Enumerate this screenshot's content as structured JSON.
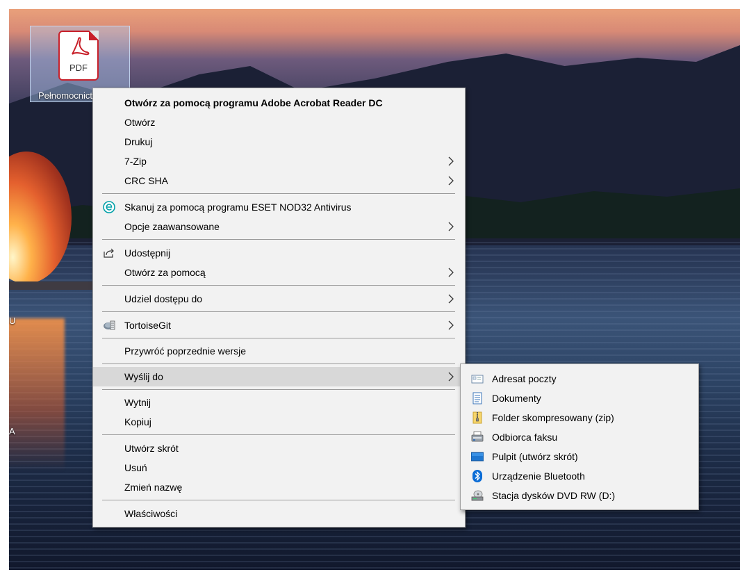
{
  "desktop": {
    "icon": {
      "label": "Pełnomocnictwo",
      "type_text": "PDF"
    },
    "edge_letters": [
      "U",
      "A"
    ]
  },
  "context_menu": {
    "items": [
      {
        "label": "Otwórz za pomocą programu Adobe Acrobat Reader DC",
        "bold": true,
        "submenu": false,
        "icon": ""
      },
      {
        "label": "Otwórz",
        "submenu": false,
        "icon": ""
      },
      {
        "label": "Drukuj",
        "submenu": false,
        "icon": ""
      },
      {
        "label": "7-Zip",
        "submenu": true,
        "icon": ""
      },
      {
        "label": "CRC SHA",
        "submenu": true,
        "icon": ""
      },
      {
        "label": "Skanuj za pomocą programu ESET NOD32 Antivirus",
        "submenu": false,
        "icon": "eset-icon"
      },
      {
        "label": "Opcje zaawansowane",
        "submenu": true,
        "icon": ""
      },
      {
        "label": "Udostępnij",
        "submenu": false,
        "icon": "share-icon"
      },
      {
        "label": "Otwórz za pomocą",
        "submenu": true,
        "icon": ""
      },
      {
        "label": "Udziel dostępu do",
        "submenu": true,
        "icon": ""
      },
      {
        "label": "TortoiseGit",
        "submenu": true,
        "icon": "tortoisegit-icon"
      },
      {
        "label": "Przywróć poprzednie wersje",
        "submenu": false,
        "icon": ""
      },
      {
        "label": "Wyślij do",
        "submenu": true,
        "icon": "",
        "highlighted": true
      },
      {
        "label": "Wytnij",
        "submenu": false,
        "icon": ""
      },
      {
        "label": "Kopiuj",
        "submenu": false,
        "icon": ""
      },
      {
        "label": "Utwórz skrót",
        "submenu": false,
        "icon": ""
      },
      {
        "label": "Usuń",
        "submenu": false,
        "icon": ""
      },
      {
        "label": "Zmień nazwę",
        "submenu": false,
        "icon": ""
      },
      {
        "label": "Właściwości",
        "submenu": false,
        "icon": ""
      }
    ]
  },
  "send_to_submenu": {
    "items": [
      {
        "label": "Adresat poczty",
        "icon": "mail-recipient-icon"
      },
      {
        "label": "Dokumenty",
        "icon": "documents-icon"
      },
      {
        "label": "Folder skompresowany (zip)",
        "icon": "zip-folder-icon"
      },
      {
        "label": "Odbiorca faksu",
        "icon": "fax-icon"
      },
      {
        "label": "Pulpit (utwórz skrót)",
        "icon": "desktop-icon"
      },
      {
        "label": "Urządzenie Bluetooth",
        "icon": "bluetooth-icon"
      },
      {
        "label": "Stacja dysków DVD RW (D:)",
        "icon": "dvd-drive-icon"
      }
    ]
  },
  "colors": {
    "menu_background": "#f2f2f2",
    "highlight": "#d8d8d8",
    "pdf_red": "#c8202a",
    "eset_teal": "#00a0a8",
    "bluetooth_blue": "#0a6cd6"
  }
}
